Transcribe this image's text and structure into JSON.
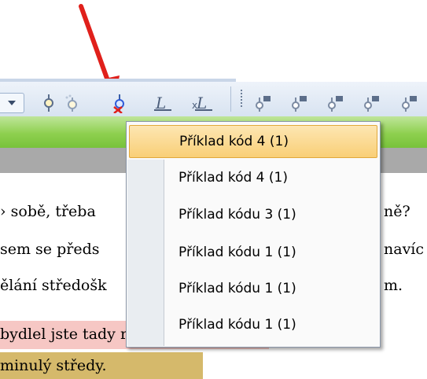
{
  "toolbar": {
    "icons": [
      "breakpoint-icon",
      "breakpoint-dotted-icon",
      "remove-bookmark-icon",
      "italic-l-icon",
      "remove-format-icon",
      "tag-icon",
      "tag-icon",
      "tag-icon",
      "tag-icon",
      "tag-icon"
    ],
    "accent_color": "#e0201b"
  },
  "document": {
    "lines": [
      "› sobě, třeba",
      "sem se předs",
      "ělání středošk"
    ],
    "right_fragments": [
      "ně?",
      "navíc",
      "m."
    ],
    "highlight_pink_text": "bydlel jste tady rán.",
    "highlight_gold_text": "minulý středy."
  },
  "menu": {
    "items": [
      {
        "label": "Příklad kód 4  (1)",
        "active": true
      },
      {
        "label": "Příklad kód 4  (1)",
        "active": false
      },
      {
        "label": "Příklad kódu 3  (1)",
        "active": false
      },
      {
        "label": "Příklad kódu 1  (1)",
        "active": false
      },
      {
        "label": "Příklad kódu 1  (1)",
        "active": false
      },
      {
        "label": "Příklad kódu 1  (1)",
        "active": false
      }
    ]
  }
}
